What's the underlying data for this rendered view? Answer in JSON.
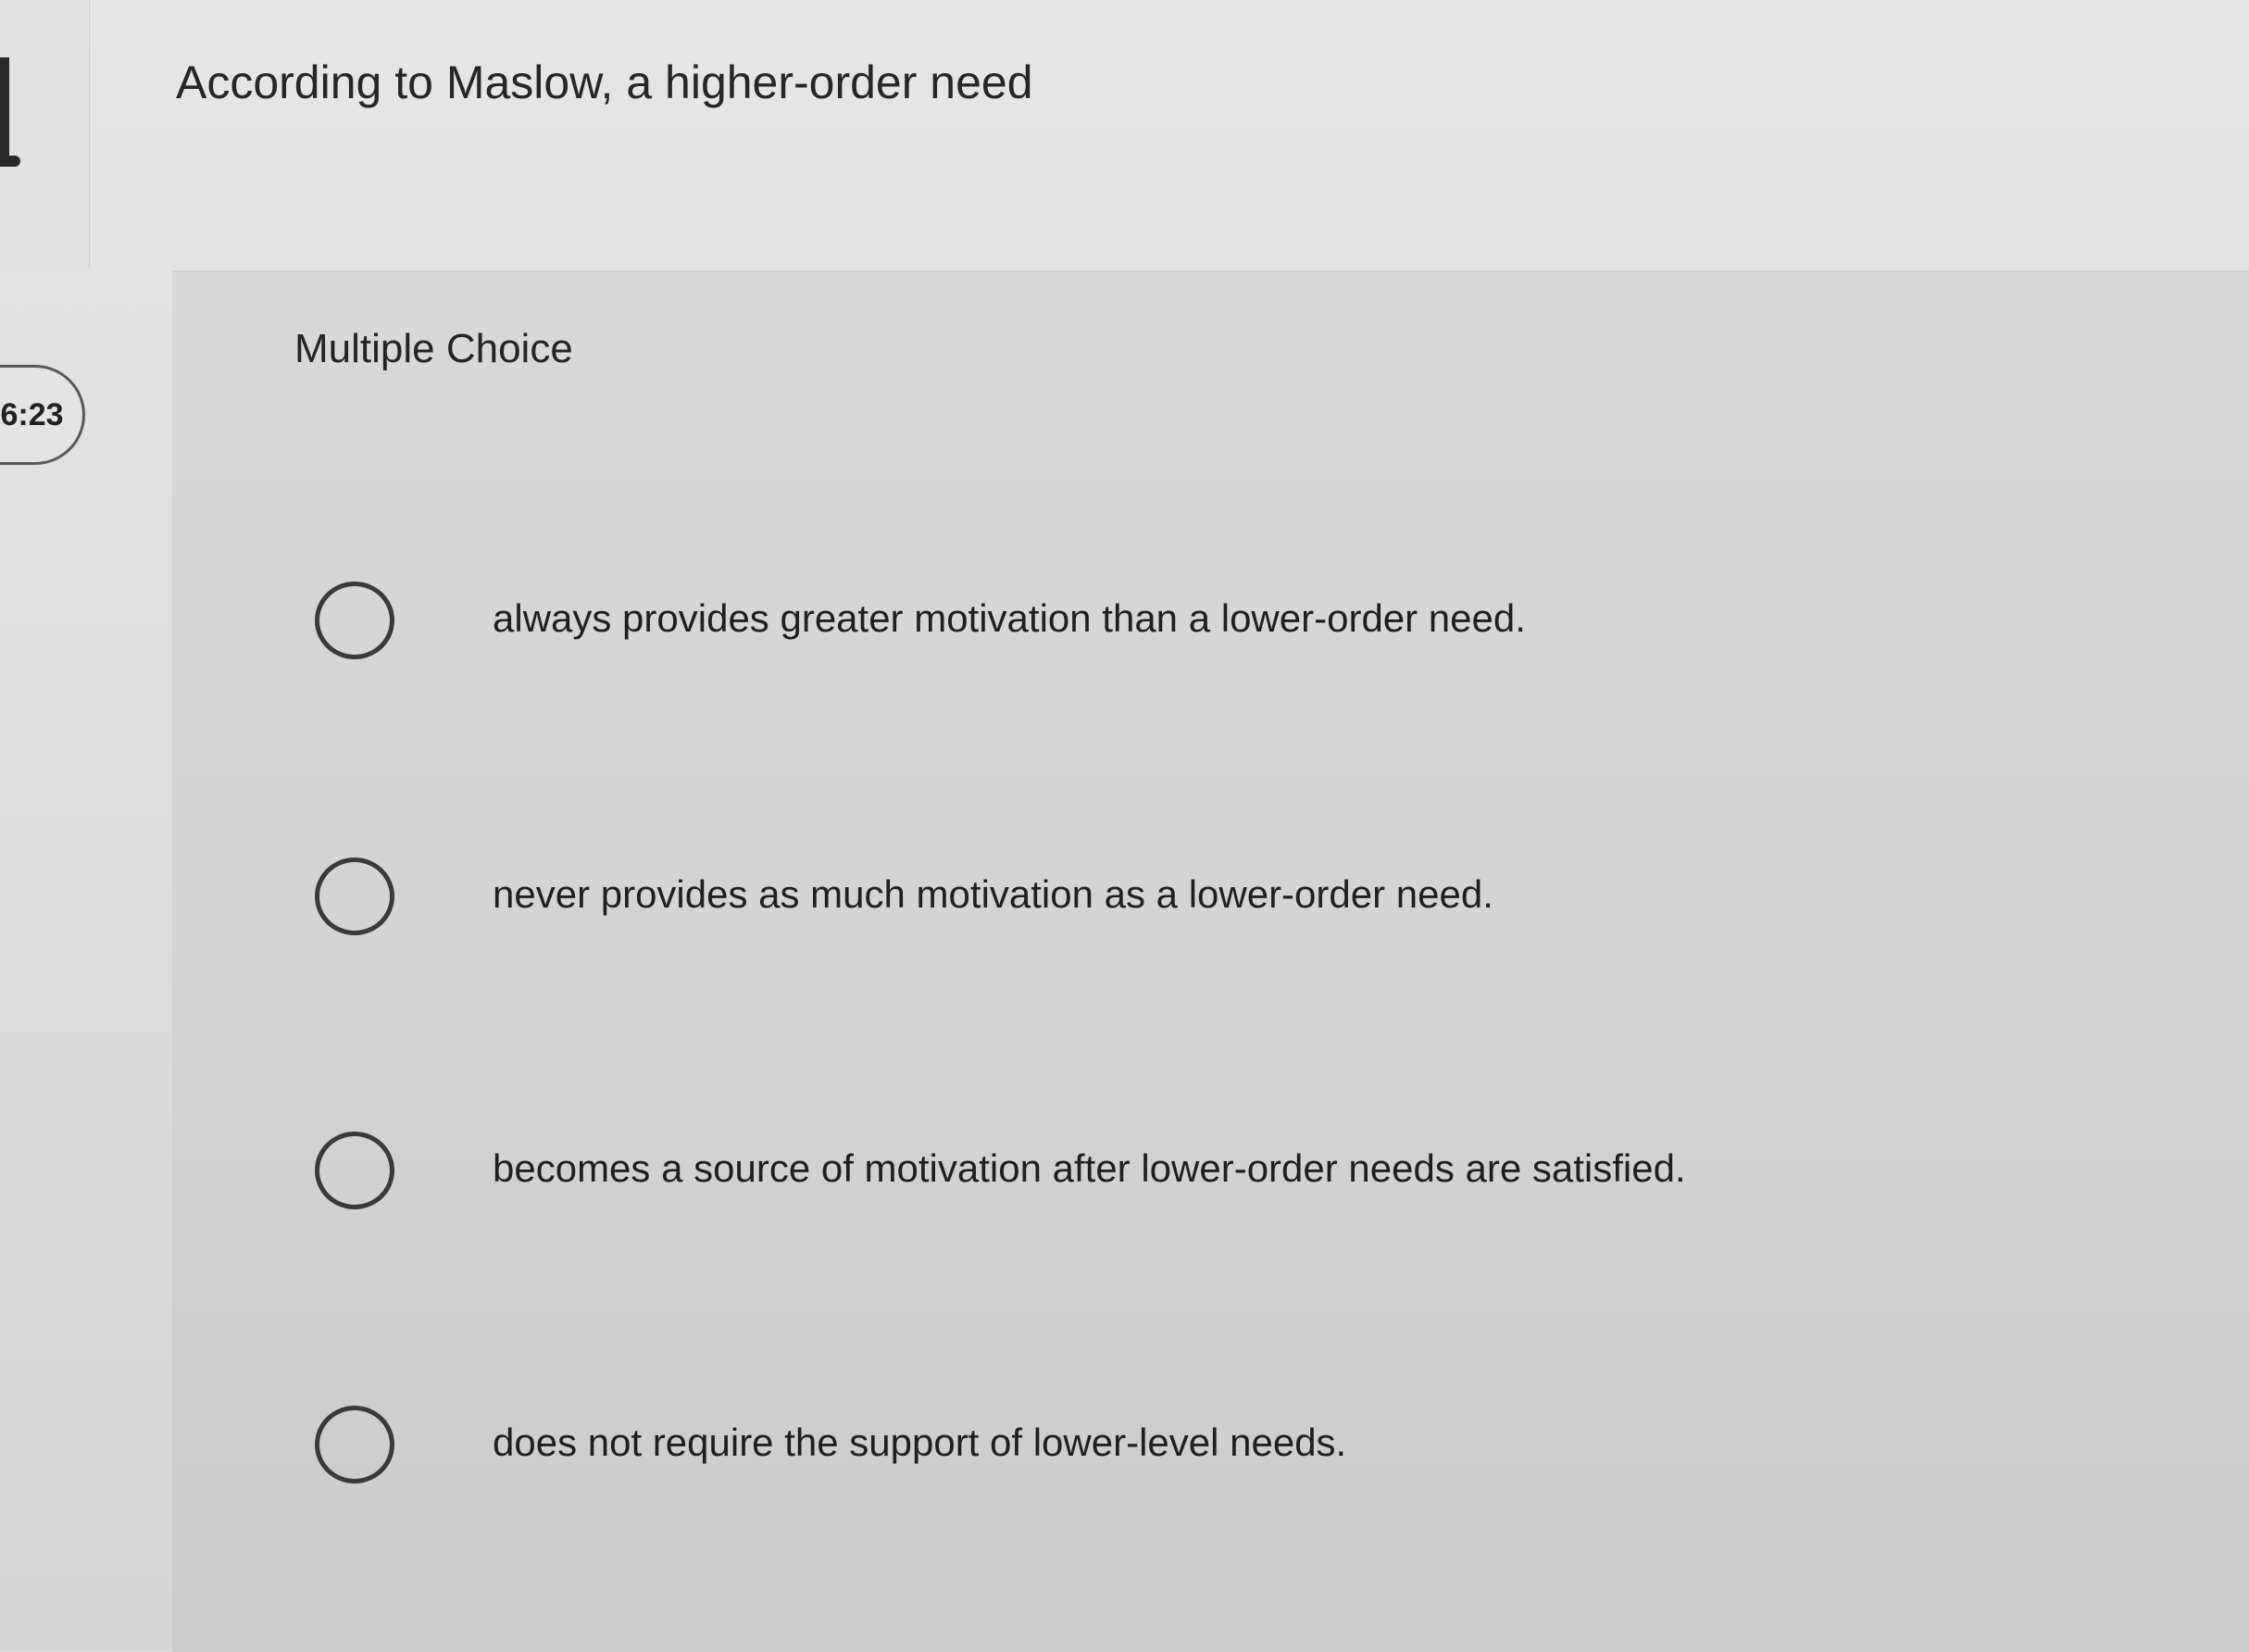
{
  "timer": {
    "value": "6:23"
  },
  "question": {
    "prompt": "According to Maslow, a higher-order need",
    "type_label": "Multiple Choice"
  },
  "options": [
    {
      "text": "always provides greater motivation than a lower-order need.",
      "selected": false
    },
    {
      "text": "never provides as much motivation as a lower-order need.",
      "selected": false
    },
    {
      "text": "becomes a source of motivation after lower-order needs are satisfied.",
      "selected": false
    },
    {
      "text": "does not require the support of lower-level needs.",
      "selected": false
    }
  ]
}
